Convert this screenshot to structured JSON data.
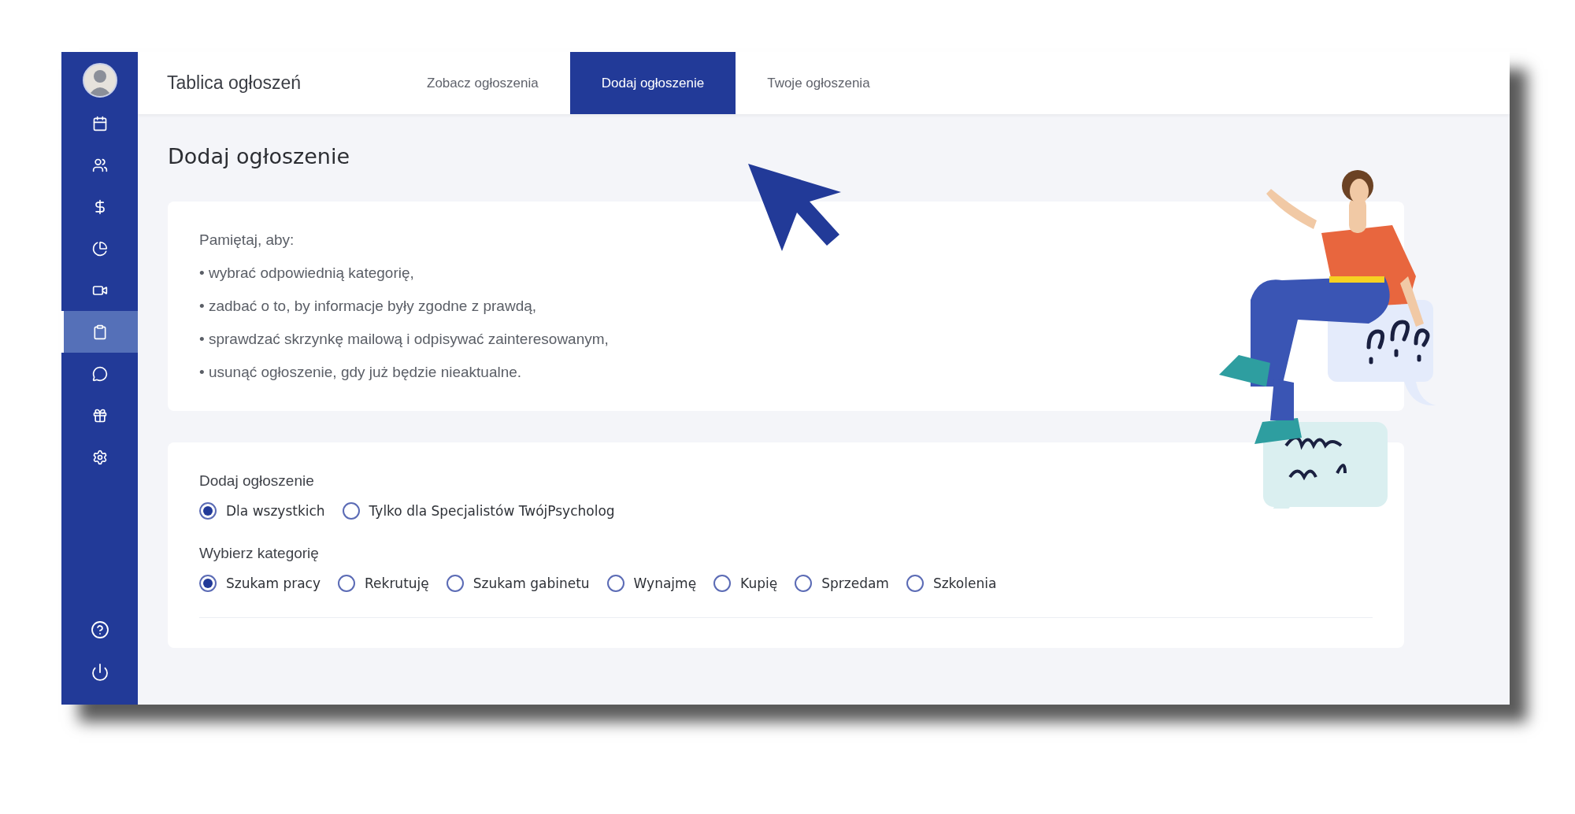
{
  "sidebar": {
    "items": [
      {
        "selected": false
      },
      {
        "selected": false
      },
      {
        "selected": false
      },
      {
        "selected": false
      },
      {
        "selected": false
      },
      {
        "selected": true
      },
      {
        "selected": false
      },
      {
        "selected": false
      },
      {
        "selected": false
      }
    ],
    "bottom_items": [
      {
        "selected": false
      },
      {
        "selected": false
      }
    ]
  },
  "top_bar": {
    "title": "Tablica ogłoszeń",
    "tabs": [
      {
        "label": "Zobacz ogłoszenia",
        "selected": false
      },
      {
        "label": "Dodaj ogłoszenie",
        "selected": true
      },
      {
        "label": "Twoje ogłoszenia",
        "selected": false
      }
    ]
  },
  "page_title": "Dodaj ogłoszenie",
  "info_card": {
    "title": "Pamiętaj, aby:",
    "bullets": [
      "• wybrać odpowiednią kategorię,",
      "• zadbać o to, by informacje były zgodne z prawdą,",
      "• sprawdzać skrzynkę mailową i odpisywać zainteresowanym,",
      "• usunąć ogłoszenie, gdy już będzie nieaktualne."
    ]
  },
  "form": {
    "groups": [
      {
        "label": "Dodaj ogłoszenie",
        "options": [
          {
            "label": "Dla wszystkich",
            "selected": true
          },
          {
            "label": "Tylko dla Specjalistów TwójPsycholog",
            "selected": false
          }
        ]
      },
      {
        "label": "Wybierz kategorię",
        "options": [
          {
            "label": "Szukam pracy",
            "selected": true
          },
          {
            "label": "Rekrutuję",
            "selected": false
          },
          {
            "label": "Szukam gabinetu",
            "selected": false
          },
          {
            "label": "Wynajmę",
            "selected": false
          },
          {
            "label": "Kupię",
            "selected": false
          },
          {
            "label": "Sprzedam",
            "selected": false
          },
          {
            "label": "Szkolenia",
            "selected": false
          }
        ]
      }
    ]
  }
}
